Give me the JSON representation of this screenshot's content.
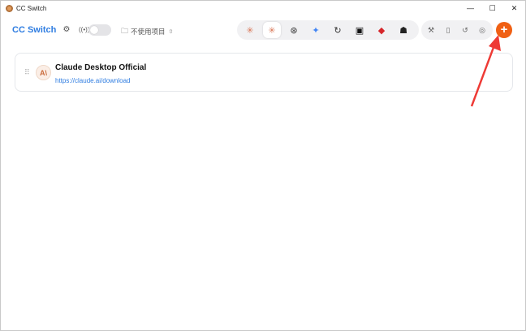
{
  "window": {
    "title": "CC Switch",
    "controls": [
      "—",
      "☐",
      "✕"
    ]
  },
  "header": {
    "brand": "CC Switch",
    "project_label": "不使用项目",
    "add_label": "+",
    "apps": [
      {
        "icon": "claude-code-icon",
        "glyph": "✳",
        "color": "#d97757"
      },
      {
        "icon": "claude-desktop-icon",
        "glyph": "✳",
        "color": "#d97757"
      },
      {
        "icon": "openai-icon",
        "glyph": "⊛",
        "color": "#333333"
      },
      {
        "icon": "gemini-icon",
        "glyph": "✦",
        "color": "#4285f4"
      },
      {
        "icon": "refresh-app-icon",
        "glyph": "↻",
        "color": "#333333"
      },
      {
        "icon": "square-app-icon",
        "glyph": "▣",
        "color": "#111111"
      },
      {
        "icon": "ruby-app-icon",
        "glyph": "◆",
        "color": "#d6262b"
      },
      {
        "icon": "mascot-app-icon",
        "glyph": "☗",
        "color": "#222222"
      }
    ],
    "tools": [
      {
        "icon": "wrench-icon",
        "glyph": "🔧"
      },
      {
        "icon": "book-icon",
        "glyph": "▯"
      },
      {
        "icon": "history-icon",
        "glyph": "↺"
      },
      {
        "icon": "fingerprint-icon",
        "glyph": "◎"
      }
    ]
  },
  "provider": {
    "logo_text": "A\\",
    "name": "Claude Desktop Official",
    "url": "https://claude.ai/download"
  },
  "annotation_color": "#ee3a35",
  "accent": "#2f7de1",
  "add_color": "#f06014"
}
